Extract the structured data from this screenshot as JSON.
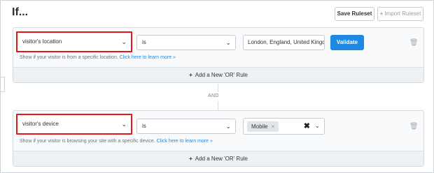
{
  "header": {
    "title": "If...",
    "save_ruleset": "Save Ruleset",
    "import_ruleset": "Import Ruleset",
    "import_icon": "plus-icon"
  },
  "rules": [
    {
      "condition": "visitor's location",
      "operator": "is",
      "value": "London, England, United Kingdom",
      "validate_label": "Validate",
      "help_text": "Show if your visitor is from a specific location.",
      "help_link": "Click here to learn more »",
      "add_or_label": "Add a New 'OR' Rule"
    },
    {
      "condition": "visitor's device",
      "operator": "is",
      "tag": "Mobile",
      "tag_remove": "×",
      "clear_glyph": "✖",
      "help_text": "Show if your visitor is browsing your site with a specific device.",
      "help_link": "Click here to learn more »",
      "add_or_label": "Add a New 'OR' Rule"
    }
  ],
  "and_label": "AND",
  "colors": {
    "accent": "#1e88e5",
    "highlight": "#e3161b"
  }
}
